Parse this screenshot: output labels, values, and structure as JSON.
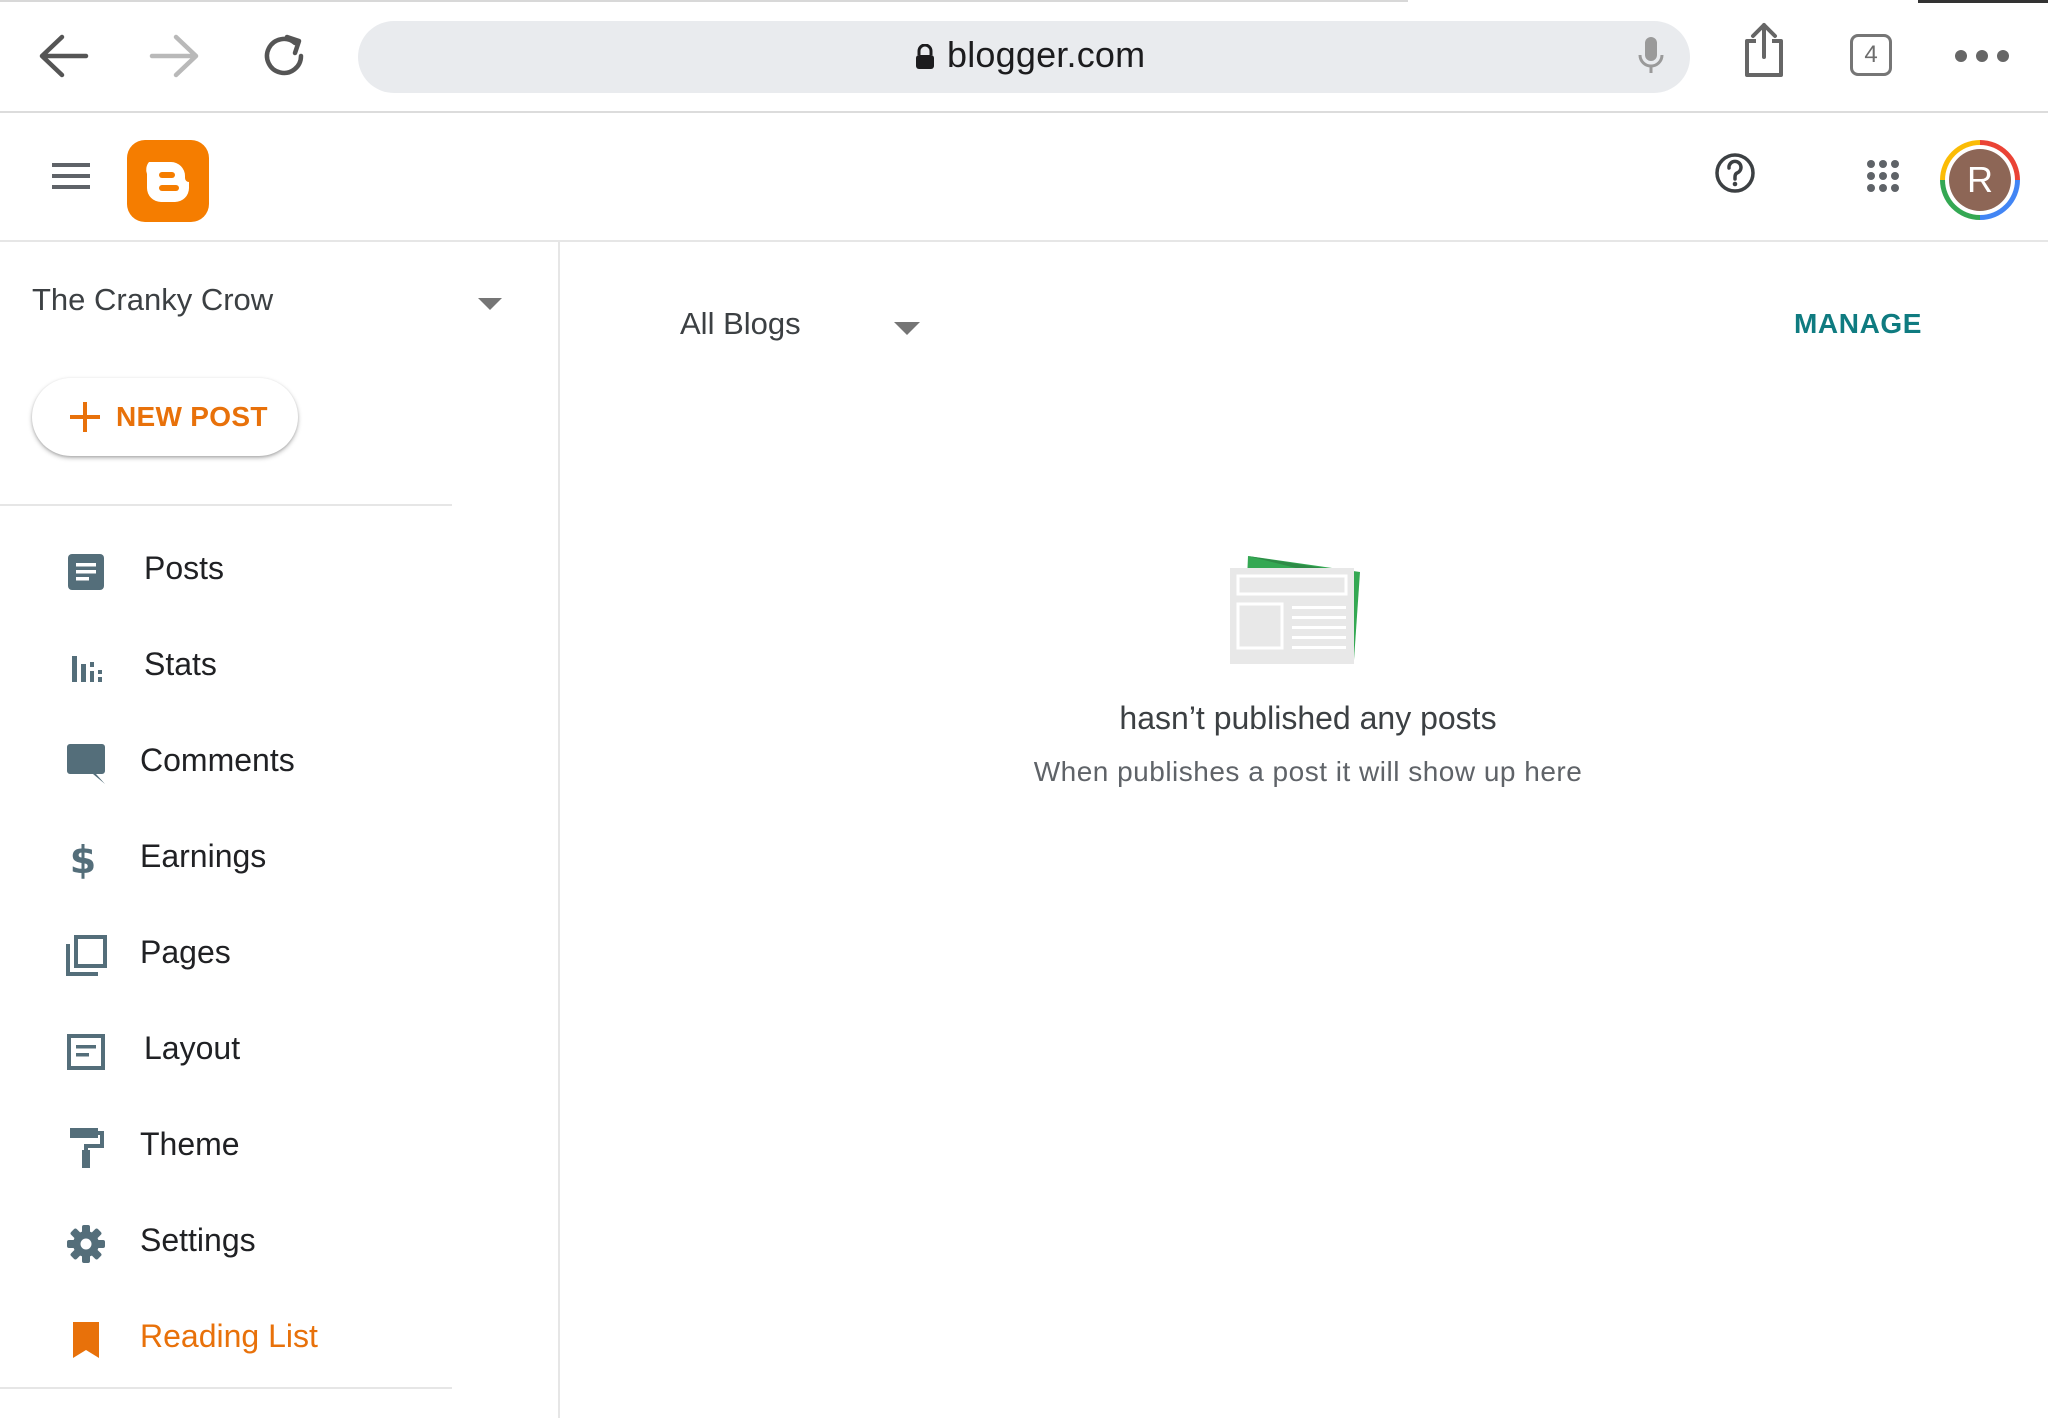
{
  "browser": {
    "url": "blogger.com",
    "tab_count": "4"
  },
  "header": {
    "avatar_initial": "R"
  },
  "sidebar": {
    "blog_name": "The Cranky Crow",
    "new_post_label": "NEW POST",
    "items": [
      {
        "label": "Posts",
        "icon": "posts-icon"
      },
      {
        "label": "Stats",
        "icon": "stats-icon"
      },
      {
        "label": "Comments",
        "icon": "comments-icon"
      },
      {
        "label": "Earnings",
        "icon": "earnings-icon"
      },
      {
        "label": "Pages",
        "icon": "pages-icon"
      },
      {
        "label": "Layout",
        "icon": "layout-icon"
      },
      {
        "label": "Theme",
        "icon": "theme-icon"
      },
      {
        "label": "Settings",
        "icon": "settings-icon"
      },
      {
        "label": "Reading List",
        "icon": "reading-list-icon"
      }
    ],
    "active_item": "Reading List"
  },
  "main": {
    "filter_label": "All Blogs",
    "manage_label": "MANAGE",
    "empty_title": "hasn’t published any posts",
    "empty_subtitle": "When publishes a post it will show up here"
  },
  "colors": {
    "accent": "#e8710a",
    "manage": "#0f7b80",
    "icon": "#546e7a"
  }
}
